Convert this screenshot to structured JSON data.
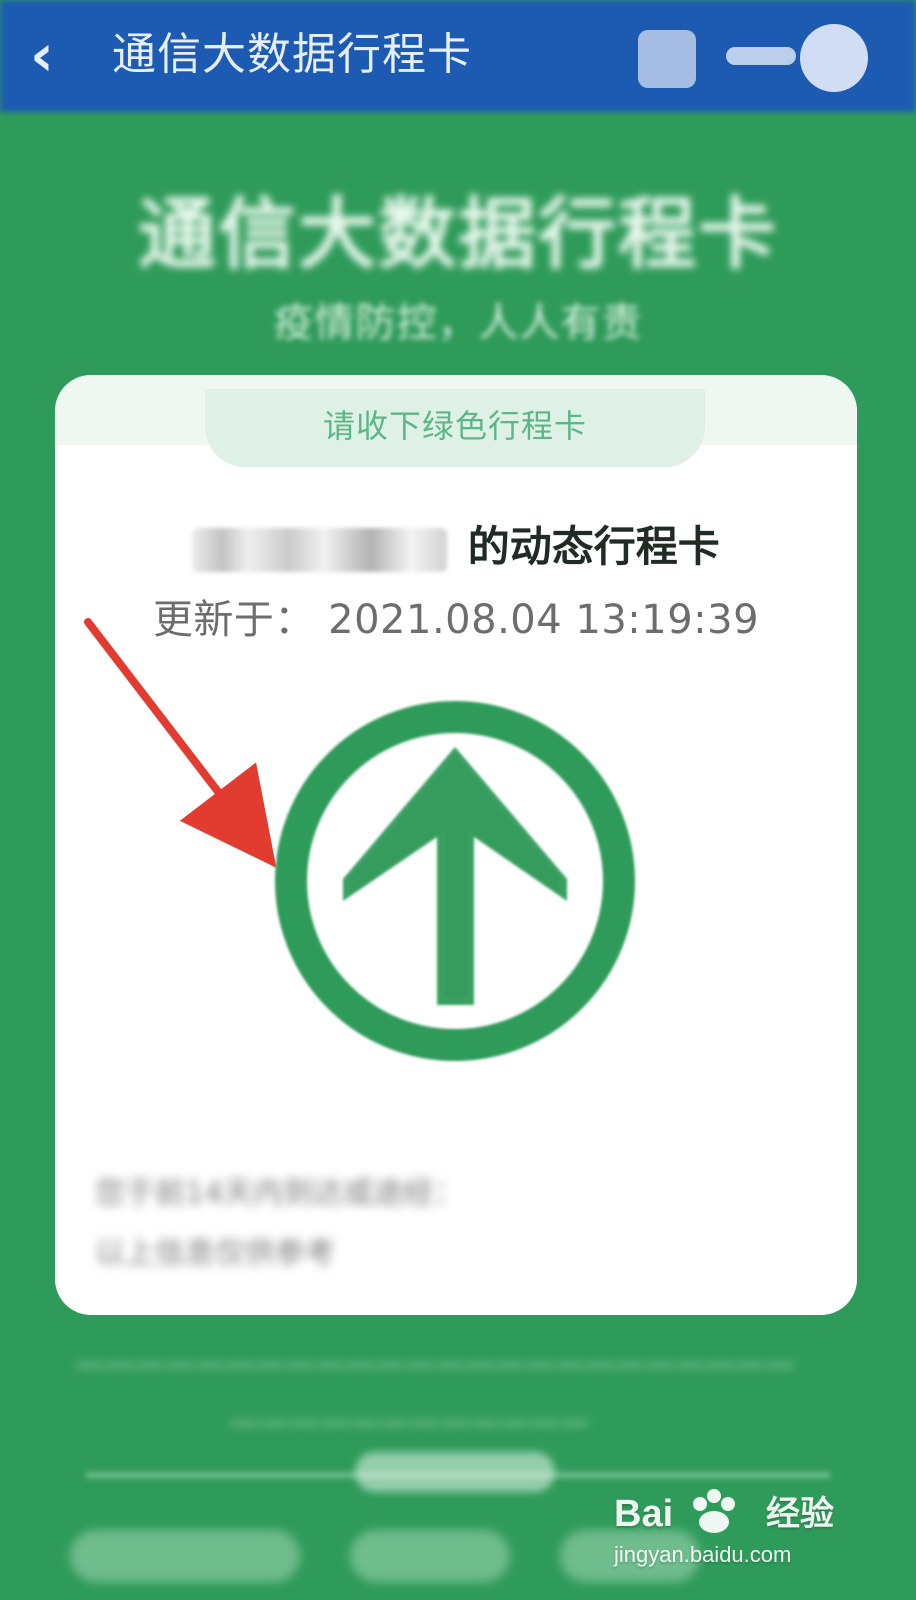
{
  "header": {
    "title": "通信大数据行程卡",
    "back_icon": "chevron-left-icon",
    "right_icons": [
      "menu-icon",
      "more-icon",
      "close-icon"
    ]
  },
  "page": {
    "title": "通信大数据行程卡",
    "subtitle": "疫情防控，人人有责"
  },
  "card": {
    "tab_label": "请收下绿色行程卡",
    "owner_suffix": "的动态行程卡",
    "updated_label": "更新于：",
    "updated_value": "2021.08.04 13:19:39",
    "badge_icon": "green-up-arrow-icon",
    "badge_color": "#2f9b5a",
    "blurred_line_1": "您于前14天内到达或途经：",
    "blurred_line_2": "以上信息仅供参考"
  },
  "annotations": {
    "pointer_color": "#e23b2f"
  },
  "watermark": {
    "brand_left": "Bai",
    "brand_right": "经验",
    "domain": "jingyan.baidu.com"
  }
}
